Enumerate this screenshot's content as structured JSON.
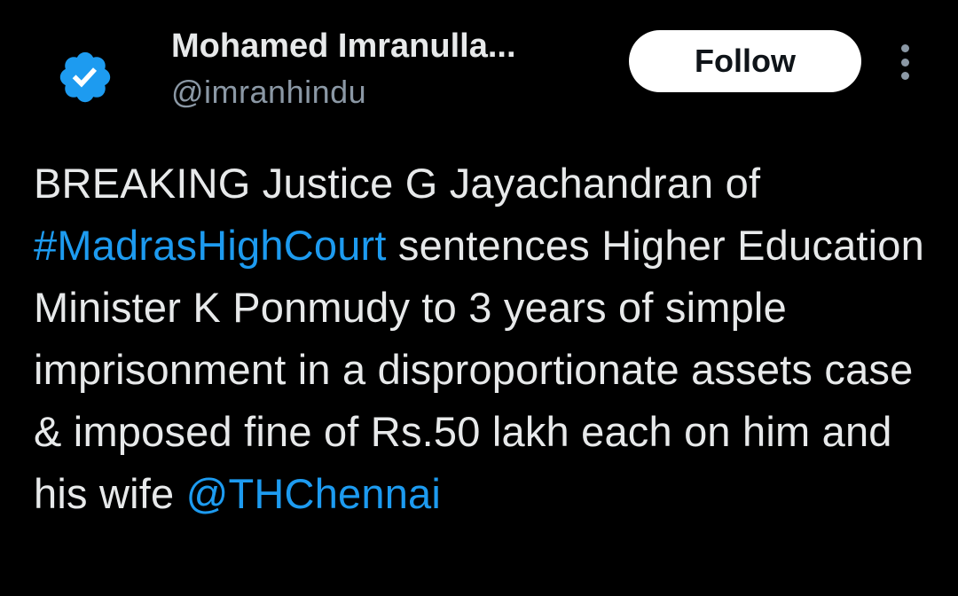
{
  "author": {
    "display_name": "Mohamed Imranulla...",
    "handle": "@imranhindu",
    "verified_icon": "verified-badge-icon",
    "verified_color": "#1d9bf0"
  },
  "actions": {
    "follow_label": "Follow",
    "more_icon": "vertical-ellipsis-icon"
  },
  "tweet": {
    "segment_1": "BREAKING Justice G Jayachandran of ",
    "hashtag": "#MadrasHighCourt",
    "segment_2": " sentences Higher Education Minister K Ponmudy to 3 years of simple imprisonment in a disproportionate assets case & imposed fine of Rs.50 lakh each on him and his wife ",
    "mention": "@THChennai"
  },
  "colors": {
    "background": "#000000",
    "text": "#e7e9ea",
    "secondary_text": "#8b98a5",
    "link": "#1d9bf0",
    "button_bg": "#ffffff"
  }
}
